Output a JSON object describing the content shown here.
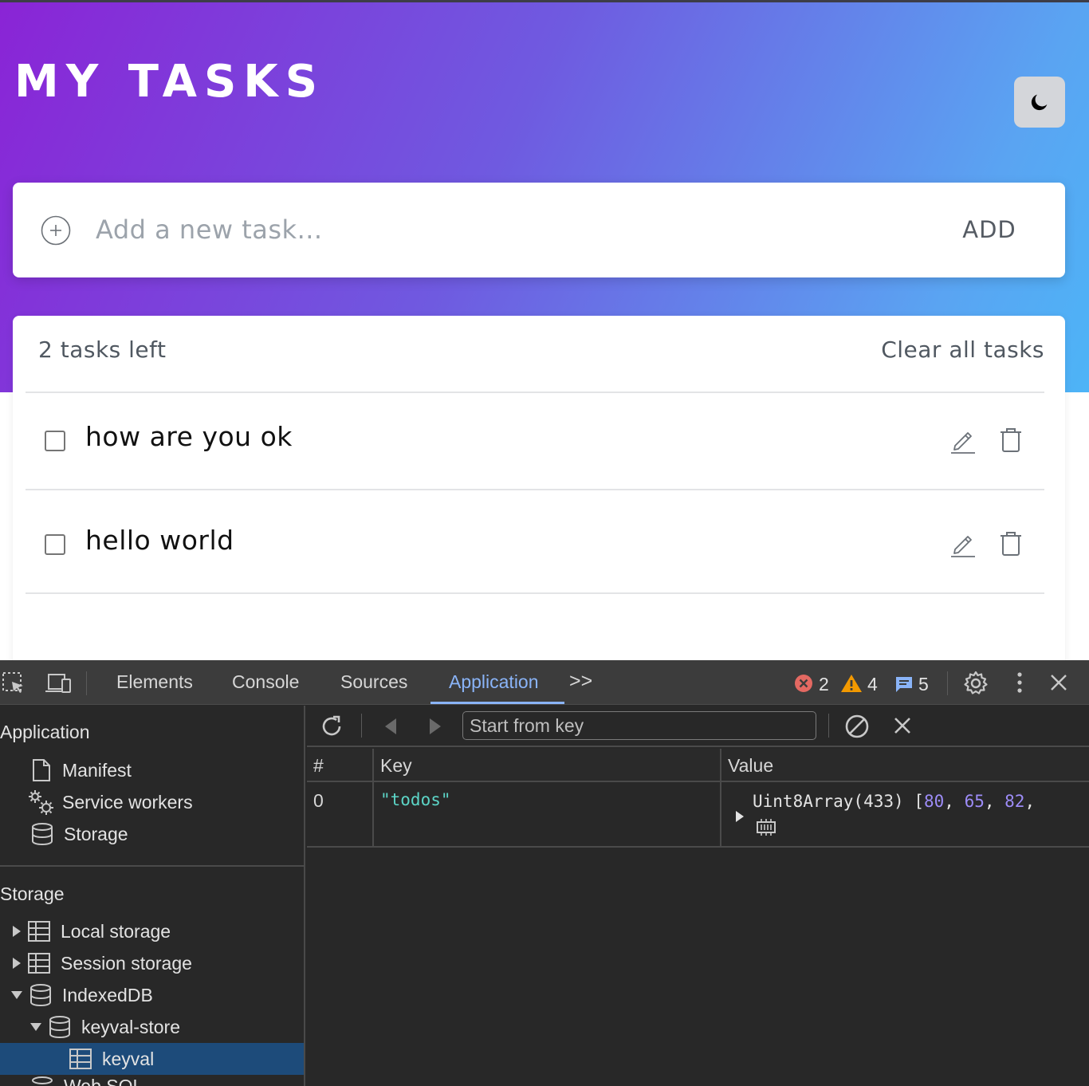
{
  "app": {
    "title": "MY TASKS",
    "add_placeholder": "Add a new task...",
    "add_label": "ADD",
    "tasks_left": "2 tasks left",
    "clear_all": "Clear all tasks",
    "tasks": [
      {
        "text": "how are you ok",
        "done": false
      },
      {
        "text": "hello world",
        "done": false
      }
    ]
  },
  "devtools": {
    "tabs": [
      "Elements",
      "Console",
      "Sources",
      "Application"
    ],
    "active_tab": "Application",
    "more_tabs": ">>",
    "errors": "2",
    "warnings": "4",
    "messages": "5",
    "sidebar": {
      "application_heading": "Application",
      "application_items": [
        "Manifest",
        "Service workers",
        "Storage"
      ],
      "storage_heading": "Storage",
      "storage_items": [
        "Local storage",
        "Session storage",
        "IndexedDB"
      ],
      "db_name": "keyval-store",
      "store_name": "keyval",
      "partial_item": "Web SQL"
    },
    "toolbar": {
      "key_placeholder": "Start from key"
    },
    "grid": {
      "headers": [
        "#",
        "Key",
        "Value"
      ],
      "row": {
        "index": "0",
        "key": "\"todos\"",
        "value_type": "Uint8Array(433)",
        "value_open": "[",
        "value_nums": [
          "80",
          "65",
          "82"
        ],
        "sep": ", "
      }
    }
  },
  "colors": {
    "gradient_start": "#8a24d6",
    "gradient_end": "#4db4f7",
    "devtools_accent": "#8ab4f8",
    "key_string": "#5cd5c7",
    "number_literal": "#9d8cf7",
    "error": "#e46962",
    "warning": "#f29900",
    "info": "#8ab4f8",
    "selected_row": "#1d4b7a"
  }
}
